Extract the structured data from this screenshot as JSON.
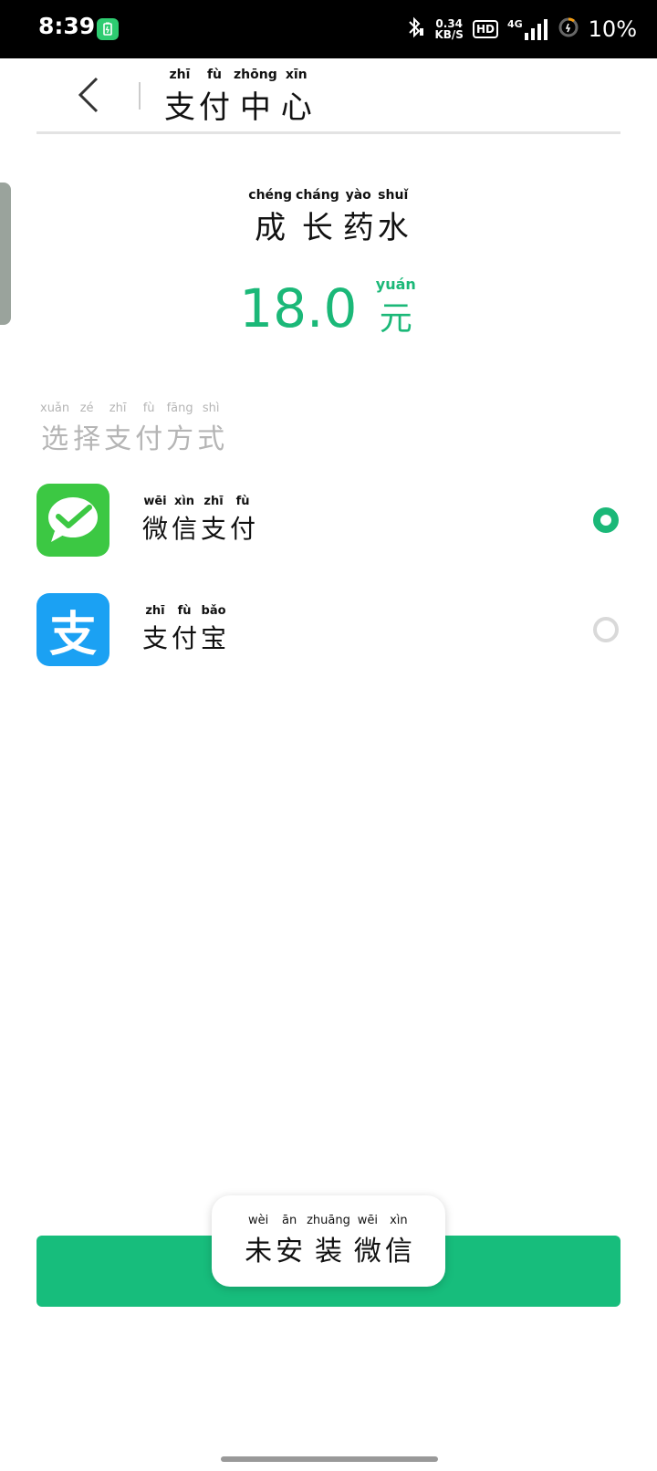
{
  "status_bar": {
    "time": "8:39",
    "speed_value": "0.34",
    "speed_unit": "KB/S",
    "hd": "HD",
    "network": "4G",
    "battery": "10%"
  },
  "header": {
    "title": [
      {
        "py": "zhī",
        "hz": "支"
      },
      {
        "py": "fù",
        "hz": "付"
      },
      {
        "py": "zhōng",
        "hz": "中"
      },
      {
        "py": "xīn",
        "hz": "心"
      }
    ]
  },
  "product": {
    "name": [
      {
        "py": "chéng",
        "hz": "成"
      },
      {
        "py": "cháng",
        "hz": "长"
      },
      {
        "py": "yào",
        "hz": "药"
      },
      {
        "py": "shuǐ",
        "hz": "水"
      }
    ],
    "price": "18.0",
    "currency": {
      "py": "yuán",
      "hz": "元"
    }
  },
  "section": {
    "label": [
      {
        "py": "xuǎn",
        "hz": "选"
      },
      {
        "py": "zé",
        "hz": "择"
      },
      {
        "py": "zhī",
        "hz": "支"
      },
      {
        "py": "fù",
        "hz": "付"
      },
      {
        "py": "fāng",
        "hz": "方"
      },
      {
        "py": "shì",
        "hz": "式"
      }
    ]
  },
  "payments": [
    {
      "id": "wechat",
      "color": "#3cc843",
      "selected": true,
      "name": [
        {
          "py": "wēi",
          "hz": "微"
        },
        {
          "py": "xìn",
          "hz": "信"
        },
        {
          "py": "zhī",
          "hz": "支"
        },
        {
          "py": "fù",
          "hz": "付"
        }
      ]
    },
    {
      "id": "alipay",
      "color": "#1ba1f3",
      "selected": false,
      "icon_glyph": "支",
      "name": [
        {
          "py": "zhī",
          "hz": "支"
        },
        {
          "py": "fù",
          "hz": "付"
        },
        {
          "py": "bǎo",
          "hz": "宝"
        }
      ]
    }
  ],
  "toast": {
    "text": [
      {
        "py": "wèi",
        "hz": "未"
      },
      {
        "py": "ān",
        "hz": "安"
      },
      {
        "py": "zhuāng",
        "hz": "装"
      },
      {
        "py": "wēi",
        "hz": "微"
      },
      {
        "py": "xìn",
        "hz": "信"
      }
    ]
  },
  "colors": {
    "accent": "#17bd7c",
    "wechat": "#3cc843",
    "alipay": "#1ba1f3"
  }
}
